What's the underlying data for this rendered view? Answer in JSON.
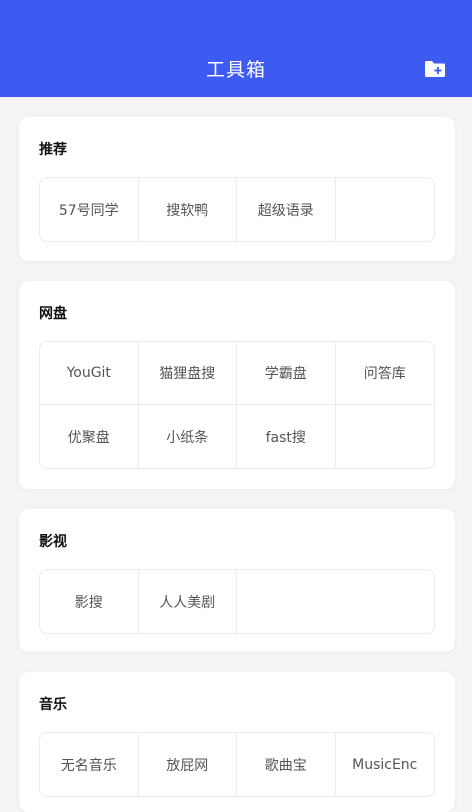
{
  "header": {
    "title": "工具箱",
    "icon": "folder-add-icon",
    "background": "#3d5af1"
  },
  "sections": [
    {
      "title": "推荐",
      "items": [
        "57号同学",
        "搜软鸭",
        "超级语录"
      ]
    },
    {
      "title": "网盘",
      "items": [
        "YouGit",
        "猫狸盘搜",
        "学霸盘",
        "问答库",
        "优聚盘",
        "小纸条",
        "fast搜"
      ]
    },
    {
      "title": "影视",
      "items": [
        "影搜",
        "人人美剧"
      ]
    },
    {
      "title": "音乐",
      "items": [
        "无名音乐",
        "放屁网",
        "歌曲宝",
        "MusicEnc"
      ]
    }
  ]
}
